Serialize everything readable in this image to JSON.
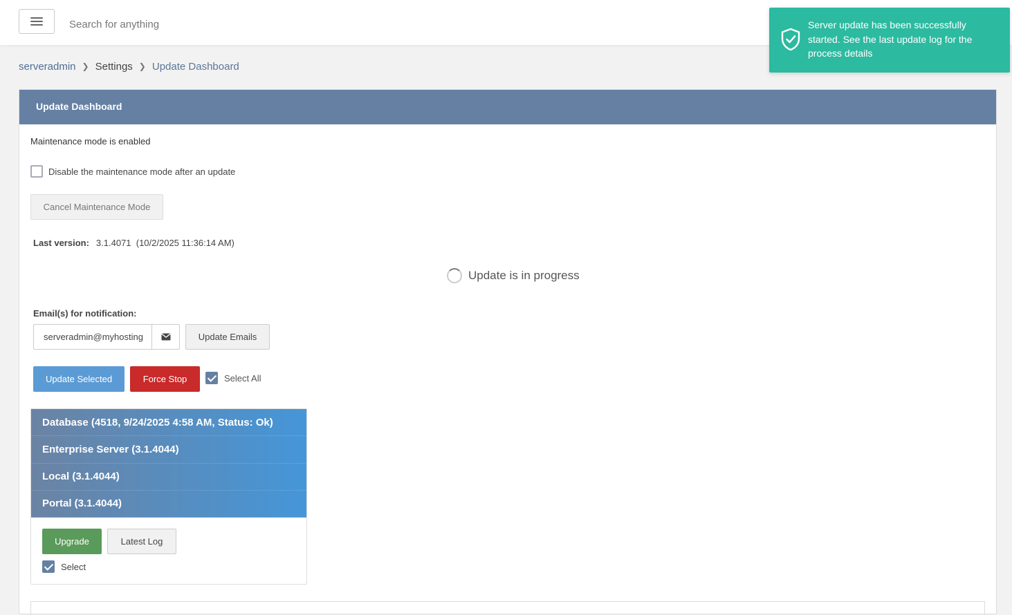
{
  "topbar": {
    "search_placeholder": "Search for anything"
  },
  "toast": {
    "message": "Server update has been successfully started. See the last update log for the process details",
    "icon": "shield-check-icon",
    "color": "#2cbaa0"
  },
  "breadcrumb": {
    "items": [
      "serveradmin",
      "Settings",
      "Update Dashboard"
    ]
  },
  "panel": {
    "title": "Update Dashboard",
    "maintenance_text": "Maintenance mode is enabled",
    "disable_checkbox_label": "Disable the maintenance mode after an update",
    "disable_checked": false,
    "cancel_button": "Cancel Maintenance Mode",
    "last_version_label": "Last version:",
    "last_version_value": "3.1.4071  (10/2/2025 11:36:14 AM)",
    "progress_text": "Update is in progress",
    "email_label": "Email(s) for notification:",
    "email_value": "serveradmin@myhosting",
    "update_emails_button": "Update Emails",
    "update_selected_button": "Update Selected",
    "force_stop_button": "Force Stop",
    "select_all_label": "Select All",
    "select_all_checked": true,
    "components": [
      "Database (4518, 9/24/2025 4:58 AM, Status: Ok)",
      "Enterprise Server (3.1.4044)",
      "Local (3.1.4044)",
      "Portal (3.1.4044)"
    ],
    "upgrade_button": "Upgrade",
    "latest_log_button": "Latest Log",
    "select_label": "Select",
    "select_checked": true
  },
  "colors": {
    "header": "#6580a3",
    "primary": "#5b9bd5",
    "danger": "#c92a2a",
    "success": "#5a9a5a"
  }
}
